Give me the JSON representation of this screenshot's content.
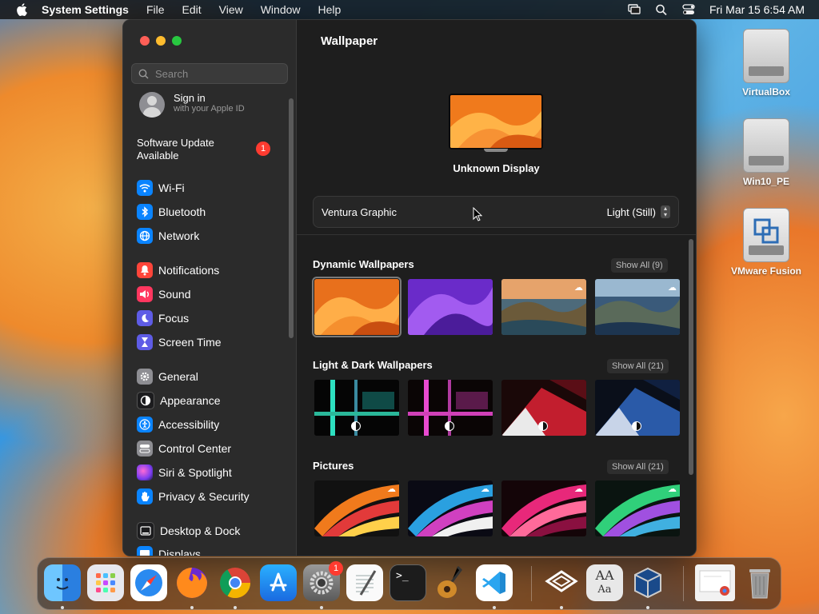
{
  "menubar": {
    "app_name": "System Settings",
    "items": [
      "File",
      "Edit",
      "View",
      "Window",
      "Help"
    ],
    "clock": "Fri Mar 15  6:54 AM"
  },
  "sidebar": {
    "search_placeholder": "Search",
    "signin_title": "Sign in",
    "signin_subtitle": "with your Apple ID",
    "update_label": "Software Update Available",
    "update_badge": "1",
    "items": [
      {
        "label": "Wi-Fi",
        "color": "#0a84ff"
      },
      {
        "label": "Bluetooth",
        "color": "#0a84ff"
      },
      {
        "label": "Network",
        "color": "#0a84ff"
      },
      {
        "label": "Notifications",
        "color": "#ff453a"
      },
      {
        "label": "Sound",
        "color": "#ff375f"
      },
      {
        "label": "Focus",
        "color": "#5e5ce6"
      },
      {
        "label": "Screen Time",
        "color": "#5e5ce6"
      },
      {
        "label": "General",
        "color": "#8e8e93"
      },
      {
        "label": "Appearance",
        "color": "#1c1c1e"
      },
      {
        "label": "Accessibility",
        "color": "#0a84ff"
      },
      {
        "label": "Control Center",
        "color": "#8e8e93"
      },
      {
        "label": "Siri & Spotlight",
        "color": "#bf5af2"
      },
      {
        "label": "Privacy & Security",
        "color": "#0a84ff"
      },
      {
        "label": "Desktop & Dock",
        "color": "#1c1c1e"
      },
      {
        "label": "Displays",
        "color": "#0a84ff"
      }
    ]
  },
  "main": {
    "title": "Wallpaper",
    "display_name": "Unknown Display",
    "wallpaper_name": "Ventura Graphic",
    "wallpaper_mode": "Light (Still)",
    "sections": [
      {
        "title": "Dynamic Wallpapers",
        "show_all": "Show All (9)"
      },
      {
        "title": "Light & Dark Wallpapers",
        "show_all": "Show All (21)"
      },
      {
        "title": "Pictures",
        "show_all": "Show All (21)"
      }
    ]
  },
  "desktop_icons": [
    "VirtualBox",
    "Win10_PE",
    "VMware Fusion"
  ],
  "dock": {
    "settings_badge": "1",
    "apps": [
      "finder-icon",
      "launchpad-icon",
      "safari-icon",
      "firefox-icon",
      "chrome-icon",
      "app-store-icon",
      "system-settings-icon",
      "textedit-icon",
      "terminal-icon",
      "garageband-icon",
      "vscode-icon",
      "vmware-icon",
      "font-book-icon",
      "virtualbox-icon",
      "preview-icon",
      "trash-icon"
    ]
  }
}
